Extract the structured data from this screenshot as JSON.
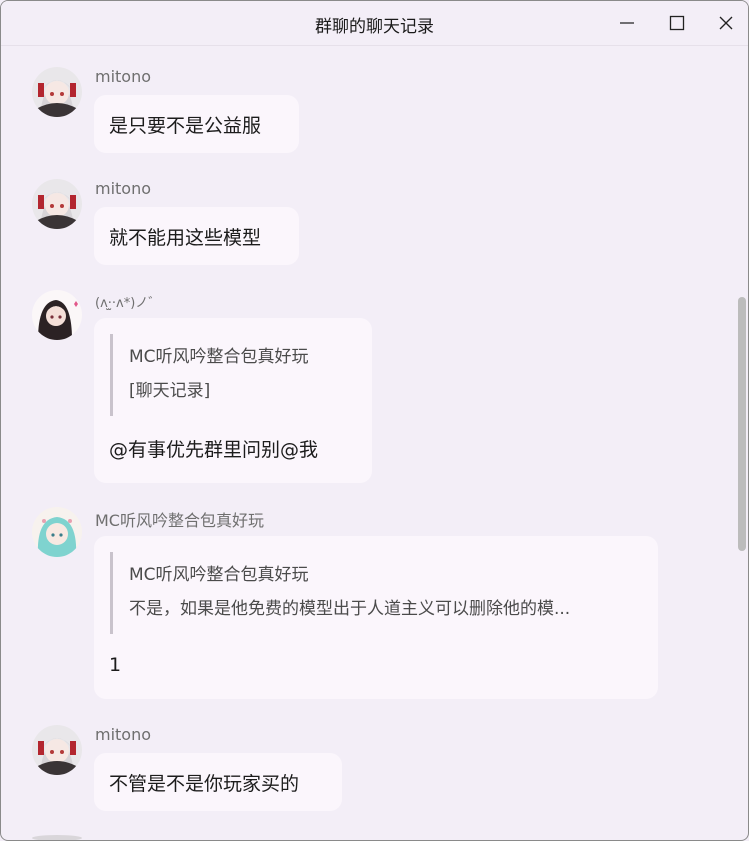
{
  "window": {
    "title": "群聊的聊天记录"
  },
  "messages": [
    {
      "sender": "mitono",
      "text": "是只要不是公益服",
      "avatar": "girl-silver-hair-avatar"
    },
    {
      "sender": "mitono",
      "text": "就不能用这些模型",
      "avatar": "girl-silver-hair-avatar"
    },
    {
      "sender": "(ʌ·̫·ʌ*)ノ゛",
      "quote_author": "MC听风吟整合包真好玩",
      "quote_text": "[聊天记录]",
      "text": "@有事优先群里问别@我",
      "avatar": "girl-dark-hair-avatar"
    },
    {
      "sender": "MC听风吟整合包真好玩",
      "quote_author": "MC听风吟整合包真好玩",
      "quote_text": "不是，如果是他免费的模型出于人道主义可以删除他的模...",
      "text": "1",
      "avatar": "girl-teal-hair-avatar"
    },
    {
      "sender": "mitono",
      "text": "不管是不是你玩家买的",
      "avatar": "girl-silver-hair-avatar"
    }
  ],
  "colors": {
    "background": "#f3eef7",
    "bubble": "#fbf6fc",
    "sender_text": "#6f6f6f",
    "quote_bar": "#c9c3cc"
  }
}
